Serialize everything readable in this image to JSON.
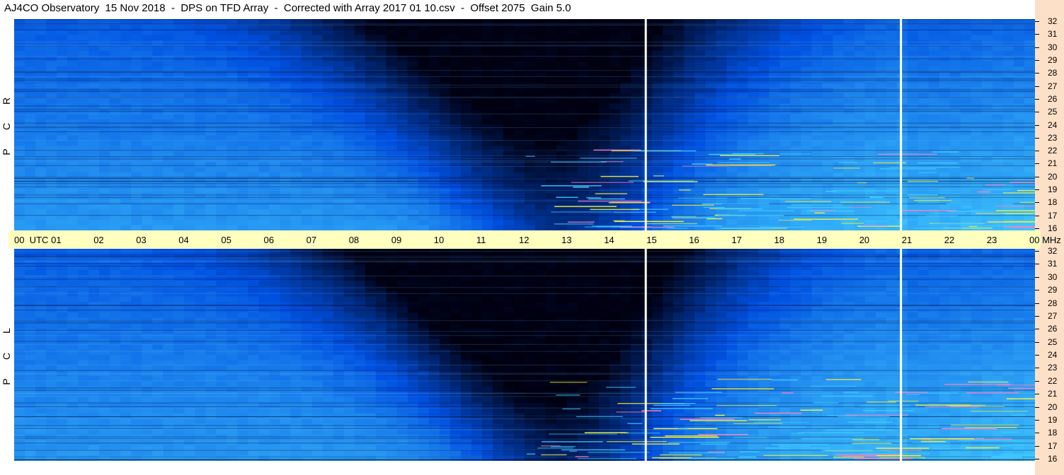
{
  "title": "AJ4CO Observatory  15 Nov 2018  -  DPS on TFD Array  -  Corrected with Array 2017 01 10.csv  -  Offset 2075  Gain 5.0",
  "chart_data": [
    {
      "type": "heatmap",
      "panel": "RCP",
      "side_label": [
        "R",
        "C",
        "P"
      ],
      "x_label": "UTC",
      "x_ticks": [
        "00",
        "01",
        "02",
        "03",
        "04",
        "05",
        "06",
        "07",
        "08",
        "09",
        "10",
        "11",
        "12",
        "13",
        "14",
        "15",
        "16",
        "17",
        "18",
        "19",
        "20",
        "21",
        "22",
        "23",
        "00"
      ],
      "x_range_utc_hours": [
        0,
        24
      ],
      "y_unit": "MHz",
      "y_ticks": [
        16,
        17,
        18,
        19,
        20,
        21,
        22,
        23,
        24,
        25,
        26,
        27,
        28,
        29,
        30,
        31,
        32
      ],
      "y_range_mhz": [
        16,
        32
      ],
      "data_gaps_utc_hours": [
        14.85,
        20.85
      ],
      "colors": {
        "low": "#000010",
        "mid": "#0050e0",
        "high": "#40c8ff",
        "hot": "#f0f040"
      }
    },
    {
      "type": "heatmap",
      "panel": "LCP",
      "side_label": [
        "L",
        "C",
        "P"
      ],
      "x_label": "UTC",
      "x_range_utc_hours": [
        0,
        24
      ],
      "y_unit": "MHz",
      "y_ticks": [
        16,
        17,
        18,
        19,
        20,
        21,
        22,
        23,
        24,
        25,
        26,
        27,
        28,
        29,
        30,
        31,
        32
      ],
      "y_range_mhz": [
        16,
        32
      ],
      "data_gaps_utc_hours": [
        14.85,
        20.85
      ]
    }
  ],
  "time_axis": {
    "first_label": "00  UTC",
    "unit_label": "00 MHz"
  }
}
